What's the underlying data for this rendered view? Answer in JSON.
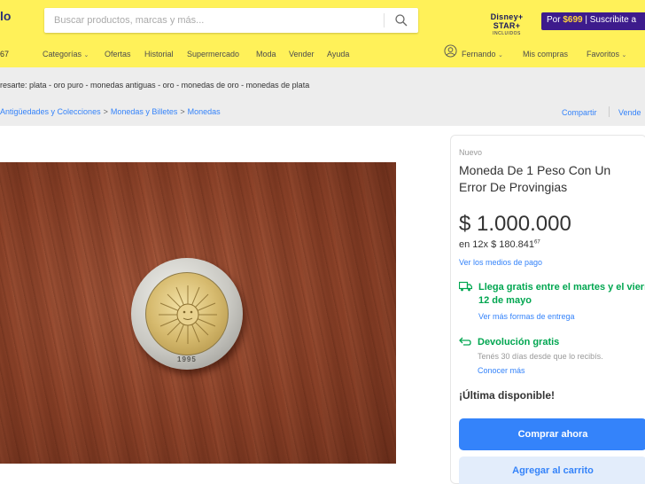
{
  "header": {
    "logo_fragment": "lo",
    "zip_fragment": "67",
    "search_placeholder": "Buscar productos, marcas y más...",
    "disney_promo": {
      "brand": "Disney+ STAR+",
      "note": "INCLUIDOS"
    },
    "subscription_promo": {
      "prefix": "Por",
      "price": "$699",
      "suffix": "Suscribite a"
    },
    "nav": [
      {
        "label": "Categorías",
        "has_dropdown": true
      },
      {
        "label": "Ofertas"
      },
      {
        "label": "Historial"
      },
      {
        "label": "Supermercado"
      },
      {
        "label": "Moda"
      },
      {
        "label": "Vender"
      },
      {
        "label": "Ayuda"
      }
    ],
    "account": {
      "user_name": "Fernando",
      "purchases": "Mis compras",
      "favorites": "Favoritos"
    }
  },
  "related_searches": "resarte: plata - oro puro - monedas antiguas - oro - monedas de oro - monedas de plata",
  "breadcrumb": [
    "Antigüedades y Colecciones",
    "Monedas y Billetes",
    "Monedas"
  ],
  "actions": {
    "share": "Compartir",
    "sell_one": "Vende"
  },
  "product": {
    "photo_alt_year": "1995",
    "condition": "Nuevo",
    "title": "Moneda De 1 Peso Con Un Error De Provingias",
    "price": "$ 1.000.000",
    "installments_prefix": "en 12x $ 180.841",
    "installments_cents": "67",
    "payment_methods_link": "Ver los medios de pago",
    "shipping": {
      "line1": "Llega gratis entre el martes y el viern",
      "line2": "12 de mayo",
      "more_link": "Ver más formas de entrega"
    },
    "returns": {
      "title": "Devolución gratis",
      "subtitle": "Tenés 30 días desde que lo recibís.",
      "more_link": "Conocer más"
    },
    "stock_note": "¡Última disponible!",
    "buy_button": "Comprar ahora",
    "cart_button": "Agregar al carrito"
  },
  "colors": {
    "header_bg": "#fff159",
    "link": "#3483fa",
    "success": "#00a650",
    "promo_bg": "#3d1b8c",
    "page_bg": "#ededed"
  }
}
